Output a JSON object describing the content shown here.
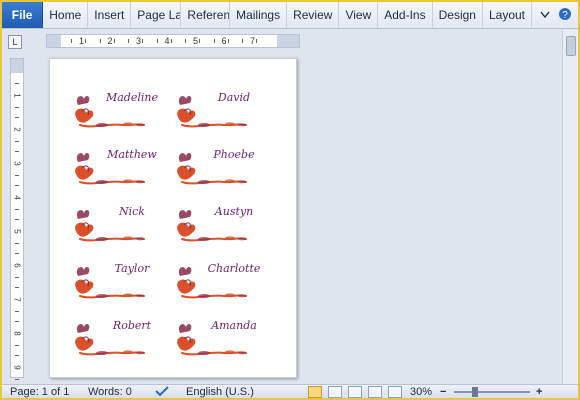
{
  "ribbon": {
    "file_label": "File",
    "tabs": [
      "Home",
      "Insert",
      "Page Lay",
      "Referenc",
      "Mailings",
      "Review",
      "View",
      "Add-Ins",
      "Design",
      "Layout"
    ],
    "help_icon": "help-icon",
    "accent": "#2b6cc4"
  },
  "ruler": {
    "corner": "L",
    "h_numbers": [
      "1",
      "2",
      "3",
      "4",
      "5",
      "6",
      "7"
    ],
    "v_numbers": [
      "1",
      "2",
      "3",
      "4",
      "5",
      "6",
      "7",
      "8",
      "9"
    ]
  },
  "cards": [
    {
      "name": "Madeline"
    },
    {
      "name": "David"
    },
    {
      "name": "Matthew"
    },
    {
      "name": "Phoebe"
    },
    {
      "name": "Nick"
    },
    {
      "name": "Austyn"
    },
    {
      "name": "Taylor"
    },
    {
      "name": "Charlotte"
    },
    {
      "name": "Robert"
    },
    {
      "name": "Amanda"
    }
  ],
  "status": {
    "page": "Page: 1 of 1",
    "words": "Words: 0",
    "language": "English (U.S.)",
    "zoom": "30%",
    "zoom_minus": "−",
    "zoom_plus": "+"
  },
  "colors": {
    "name_text": "#6b1f6b",
    "flower_primary": "#d9502a",
    "flower_secondary": "#8a2a4a"
  }
}
